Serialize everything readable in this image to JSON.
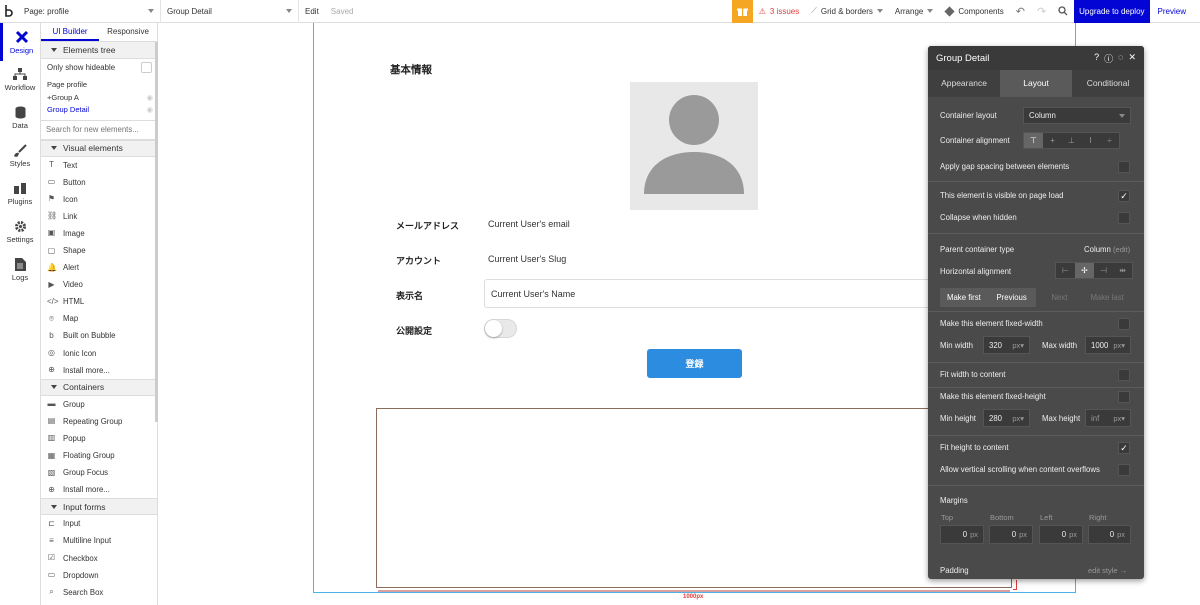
{
  "topbar": {
    "page_label": "Page: profile",
    "element_label": "Group Detail",
    "edit": "Edit",
    "saved": "Saved",
    "issues": "3 issues",
    "grid": "Grid & borders",
    "arrange": "Arrange",
    "components": "Components",
    "upgrade": "Upgrade to deploy",
    "preview": "Preview"
  },
  "nav": {
    "items": [
      {
        "label": "Design"
      },
      {
        "label": "Workflow"
      },
      {
        "label": "Data"
      },
      {
        "label": "Styles"
      },
      {
        "label": "Plugins"
      },
      {
        "label": "Settings"
      },
      {
        "label": "Logs"
      }
    ]
  },
  "panel": {
    "tabs": [
      "UI Builder",
      "Responsive"
    ],
    "tree_title": "Elements tree",
    "only_hideable": "Only show hideable",
    "tree": [
      "Page profile",
      "Group A",
      "Group Detail"
    ],
    "search_placeholder": "Search for new elements...",
    "visual_title": "Visual elements",
    "visual": [
      "Text",
      "Button",
      "Icon",
      "Link",
      "Image",
      "Shape",
      "Alert",
      "Video",
      "HTML",
      "Map",
      "Built on Bubble",
      "Ionic Icon",
      "Install more..."
    ],
    "containers_title": "Containers",
    "containers": [
      "Group",
      "Repeating Group",
      "Popup",
      "Floating Group",
      "Group Focus",
      "Install more..."
    ],
    "inputs_title": "Input forms",
    "inputs": [
      "Input",
      "Multiline Input",
      "Checkbox",
      "Dropdown",
      "Search Box"
    ]
  },
  "canvas": {
    "heading": "基本情報",
    "email_label": "メールアドレス",
    "email_value": "Current User's email",
    "account_label": "アカウント",
    "account_value": "Current User's Slug",
    "name_label": "表示名",
    "name_value": "Current User's Name",
    "public_label": "公開設定",
    "register_button": "登録",
    "width_tag": "1000px"
  },
  "inspector": {
    "title": "Group Detail",
    "tabs": [
      "Appearance",
      "Layout",
      "Conditional"
    ],
    "container_layout_label": "Container layout",
    "container_layout_value": "Column",
    "container_alignment_label": "Container alignment",
    "gap_label": "Apply gap spacing between elements",
    "visible_label": "This element is visible on page load",
    "collapse_label": "Collapse when hidden",
    "parent_type_label": "Parent container type",
    "parent_type_value": "Column",
    "parent_type_edit": "(edit)",
    "halign_label": "Horizontal alignment",
    "order_buttons": [
      "Make first",
      "Previous",
      "Next",
      "Make last"
    ],
    "fixed_width_label": "Make this element fixed-width",
    "min_width_label": "Min width",
    "min_width_value": "320",
    "max_width_label": "Max width",
    "max_width_value": "1000",
    "unit": "px",
    "fit_width_label": "Fit width to content",
    "fixed_height_label": "Make this element fixed-height",
    "min_height_label": "Min height",
    "min_height_value": "280",
    "max_height_label": "Max height",
    "max_height_value": "inf",
    "fit_height_label": "Fit height to content",
    "scroll_label": "Allow vertical scrolling when content overflows",
    "margins_label": "Margins",
    "margin_names": [
      "Top",
      "Bottom",
      "Left",
      "Right"
    ],
    "margin_values": [
      "0",
      "0",
      "0",
      "0"
    ],
    "padding_label": "Padding",
    "edit_style": "edit style →"
  },
  "colors": {
    "accent": "#0205d3",
    "button": "#2b8ce0",
    "inspector_bg": "#4a4a4a"
  }
}
